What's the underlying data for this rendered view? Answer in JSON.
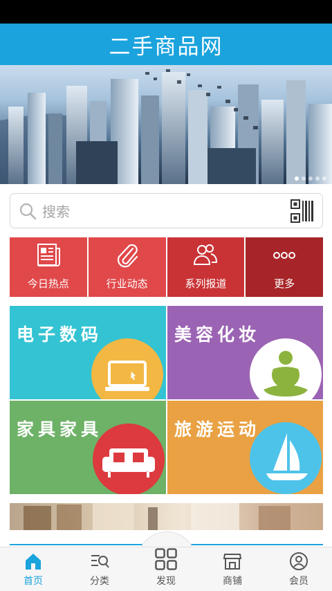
{
  "header": {
    "title": "二手商品网"
  },
  "banner": {
    "image": "city-skyline-banner",
    "slides": 5,
    "active_slide": 1
  },
  "search": {
    "placeholder": "搜索",
    "icon": "search-icon",
    "scan_icon": "qr-code-icon"
  },
  "quick_nav": [
    {
      "label": "今日热点",
      "icon": "newspaper-icon",
      "color": "#e0484a"
    },
    {
      "label": "行业动态",
      "icon": "paperclip-icon",
      "color": "#e0484a"
    },
    {
      "label": "系列报道",
      "icon": "users-icon",
      "color": "#c93336"
    },
    {
      "label": "更多",
      "icon": "more-icon",
      "color": "#a72528"
    }
  ],
  "categories": [
    {
      "label": "电子数码",
      "icon": "laptop-icon",
      "color": "#33c3d3",
      "circle": "#f3b744"
    },
    {
      "label": "美容化妆",
      "icon": "meditation-icon",
      "color": "#9b63b3",
      "circle": "#ffffff"
    },
    {
      "label": "家具家具",
      "icon": "sofa-icon",
      "color": "#6db267",
      "circle": "#dc3a3f"
    },
    {
      "label": "旅游运动",
      "icon": "sailboat-icon",
      "color": "#e9a143",
      "circle": "#4ec3ea"
    }
  ],
  "tabs": [
    {
      "label": "首页",
      "icon": "home-icon",
      "active": true
    },
    {
      "label": "分类",
      "icon": "category-search-icon",
      "active": false
    },
    {
      "label": "发现",
      "icon": "grid-icon",
      "active": false
    },
    {
      "label": "商铺",
      "icon": "store-icon",
      "active": false
    },
    {
      "label": "会员",
      "icon": "member-icon",
      "active": false
    }
  ],
  "colors": {
    "accent": "#1ba3dd",
    "status_bar": "#000000"
  }
}
